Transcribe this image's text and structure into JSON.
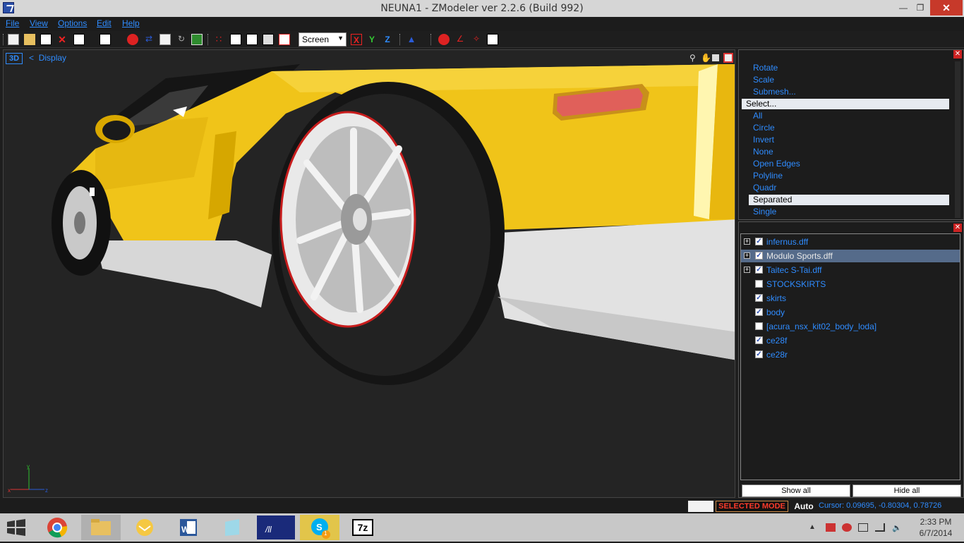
{
  "window": {
    "title": "NEUNA1 - ZModeler ver 2.2.6 (Build 992)"
  },
  "menu": [
    "File",
    "View",
    "Options",
    "Edit",
    "Help"
  ],
  "toolbar": {
    "view_select": "Screen",
    "axis_x": "X",
    "axis_y": "Y",
    "axis_z": "Z"
  },
  "viewport": {
    "mode_badge": "3D",
    "breadcrumb": "Display",
    "breadcrumb_prefix": "<"
  },
  "commands": {
    "items": [
      {
        "label": "Rotate",
        "highlighted": false
      },
      {
        "label": "Scale",
        "highlighted": false
      },
      {
        "label": "Submesh...",
        "highlighted": false
      },
      {
        "label": "Select...",
        "highlighted": true
      },
      {
        "label": "All",
        "highlighted": false
      },
      {
        "label": "Circle",
        "highlighted": false
      },
      {
        "label": "Invert",
        "highlighted": false
      },
      {
        "label": "None",
        "highlighted": false
      },
      {
        "label": "Open Edges",
        "highlighted": false
      },
      {
        "label": "Polyline",
        "highlighted": false
      },
      {
        "label": "Quadr",
        "highlighted": false
      },
      {
        "label": "Separated",
        "highlighted": true
      },
      {
        "label": "Single",
        "highlighted": false
      }
    ]
  },
  "objects": {
    "items": [
      {
        "label": "infernus.dff",
        "expandable": true,
        "checked": true,
        "selected": false
      },
      {
        "label": "Modulo Sports.dff",
        "expandable": true,
        "checked": true,
        "selected": true
      },
      {
        "label": "Taitec S-Tai.dff",
        "expandable": true,
        "checked": true,
        "selected": false
      },
      {
        "label": "STOCKSKIRTS",
        "expandable": false,
        "checked": false,
        "selected": false
      },
      {
        "label": "skirts",
        "expandable": false,
        "checked": true,
        "selected": false
      },
      {
        "label": "body",
        "expandable": false,
        "checked": true,
        "selected": false
      },
      {
        "label": "[acura_nsx_kit02_body_loda]",
        "expandable": false,
        "checked": false,
        "selected": false
      },
      {
        "label": "ce28f",
        "expandable": false,
        "checked": true,
        "selected": false
      },
      {
        "label": "ce28r",
        "expandable": false,
        "checked": true,
        "selected": false
      }
    ],
    "show_all": "Show all",
    "hide_all": "Hide all"
  },
  "status": {
    "mode": "SELECTED MODE",
    "auto": "Auto",
    "cursor": "Cursor: 0.09695, -0.80304, 0.78726"
  },
  "taskbar": {
    "time": "2:33 PM",
    "date": "6/7/2014",
    "apps": [
      "chrome-icon",
      "file-explorer-icon",
      "outlook-icon",
      "word-icon",
      "notes-icon",
      "asus-icon",
      "skype-icon",
      "7zip-icon"
    ],
    "seven_zip_label": "7z",
    "skype_badge": "1"
  },
  "colors": {
    "accent": "#2f8cff",
    "car_body": "#f0c419",
    "status_mode": "#ff3b2b"
  }
}
